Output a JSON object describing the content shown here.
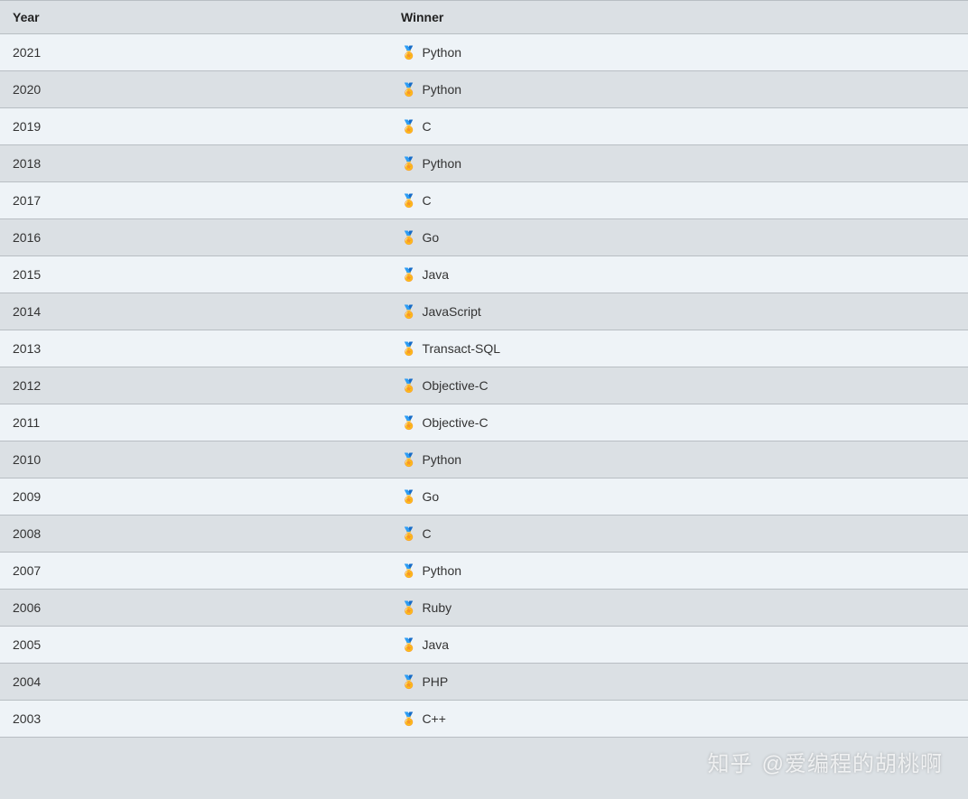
{
  "table": {
    "headers": {
      "year": "Year",
      "winner": "Winner"
    },
    "rows": [
      {
        "year": "2021",
        "winner": "Python"
      },
      {
        "year": "2020",
        "winner": "Python"
      },
      {
        "year": "2019",
        "winner": "C"
      },
      {
        "year": "2018",
        "winner": "Python"
      },
      {
        "year": "2017",
        "winner": "C"
      },
      {
        "year": "2016",
        "winner": "Go"
      },
      {
        "year": "2015",
        "winner": "Java"
      },
      {
        "year": "2014",
        "winner": "JavaScript"
      },
      {
        "year": "2013",
        "winner": "Transact-SQL"
      },
      {
        "year": "2012",
        "winner": "Objective-C"
      },
      {
        "year": "2011",
        "winner": "Objective-C"
      },
      {
        "year": "2010",
        "winner": "Python"
      },
      {
        "year": "2009",
        "winner": "Go"
      },
      {
        "year": "2008",
        "winner": "C"
      },
      {
        "year": "2007",
        "winner": "Python"
      },
      {
        "year": "2006",
        "winner": "Ruby"
      },
      {
        "year": "2005",
        "winner": "Java"
      },
      {
        "year": "2004",
        "winner": "PHP"
      },
      {
        "year": "2003",
        "winner": "C++"
      }
    ],
    "medal_glyph": "🏅"
  },
  "watermark": {
    "prefix": "知乎",
    "handle": "@爱编程的胡桃啊"
  }
}
